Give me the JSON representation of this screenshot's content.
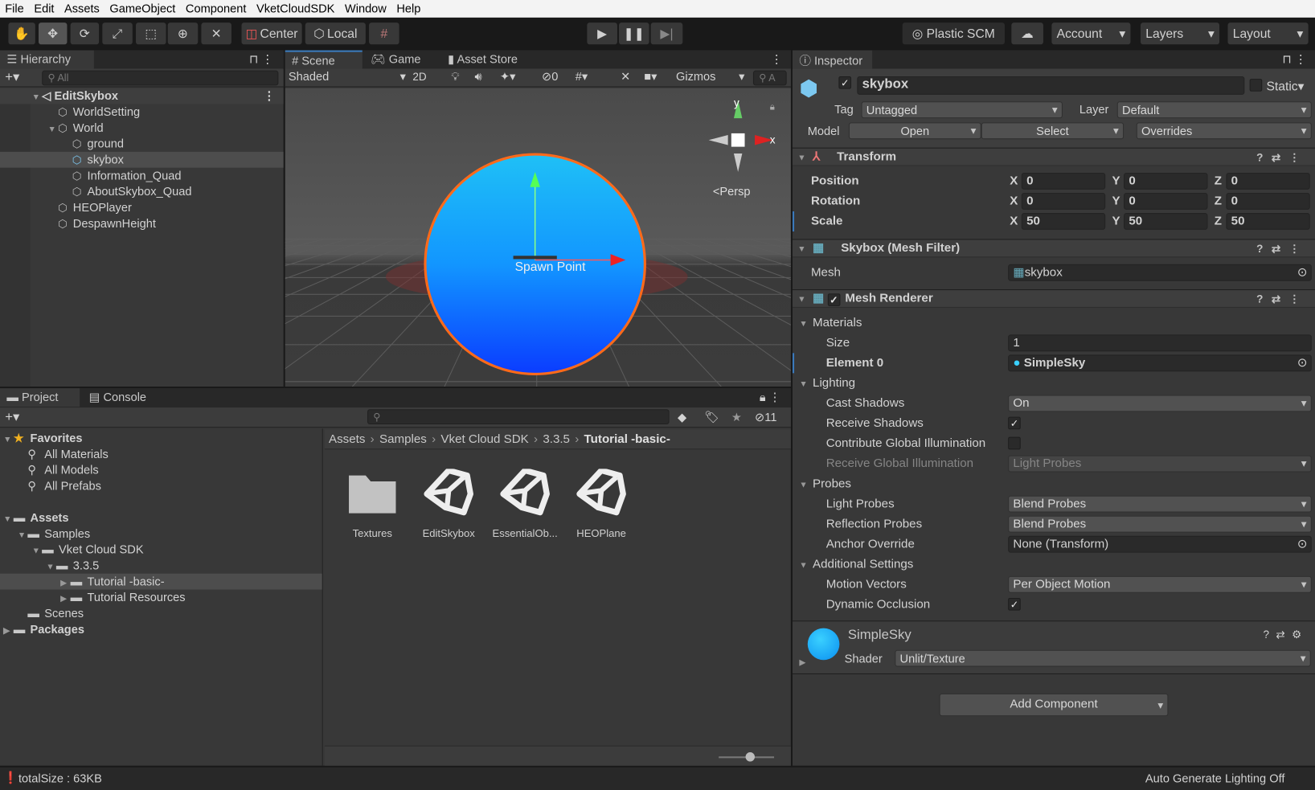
{
  "menu": [
    "File",
    "Edit",
    "Assets",
    "GameObject",
    "Component",
    "VketCloudSDK",
    "Window",
    "Help"
  ],
  "toolbar": {
    "tools": [
      "hand-tool",
      "move-tool",
      "rotate-tool",
      "scale-tool",
      "rect-tool",
      "transform-tool",
      "custom-tool"
    ],
    "center": "Center",
    "local": "Local",
    "plastic": "Plastic SCM",
    "account": "Account",
    "layers": "Layers",
    "layout": "Layout"
  },
  "hierarchy": {
    "title": "Hierarchy",
    "search_placeholder": "All",
    "scene": "EditSkybox",
    "items": [
      {
        "label": "WorldSetting",
        "depth": 1
      },
      {
        "label": "World",
        "depth": 1,
        "expanded": true
      },
      {
        "label": "ground",
        "depth": 2
      },
      {
        "label": "skybox",
        "depth": 2,
        "selected": true
      },
      {
        "label": "Information_Quad",
        "depth": 2
      },
      {
        "label": "AboutSkybox_Quad",
        "depth": 2
      },
      {
        "label": "HEOPlayer",
        "depth": 1
      },
      {
        "label": "DespawnHeight",
        "depth": 1
      }
    ]
  },
  "scene": {
    "tabs": [
      "Scene",
      "Game",
      "Asset Store"
    ],
    "shading": "Shaded",
    "mode2d": "2D",
    "hidden_count": "0",
    "gizmos": "Gizmos",
    "search": "A",
    "persp": "Persp",
    "spawn": "Spawn Point",
    "axis_x": "x",
    "axis_y": "y"
  },
  "inspector": {
    "title": "Inspector",
    "name": "skybox",
    "static": "Static",
    "tag_label": "Tag",
    "tag": "Untagged",
    "layer_label": "Layer",
    "layer": "Default",
    "model_label": "Model",
    "open": "Open",
    "select": "Select",
    "overrides": "Overrides",
    "transform": {
      "title": "Transform",
      "rows": [
        {
          "label": "Position",
          "x": "0",
          "y": "0",
          "z": "0"
        },
        {
          "label": "Rotation",
          "x": "0",
          "y": "0",
          "z": "0"
        },
        {
          "label": "Scale",
          "x": "50",
          "y": "50",
          "z": "50"
        }
      ]
    },
    "mesh_filter": {
      "title": "Skybox (Mesh Filter)",
      "mesh_label": "Mesh",
      "mesh": "skybox"
    },
    "mesh_renderer": {
      "title": "Mesh Renderer",
      "rows": [
        {
          "type": "fold",
          "label": "Materials"
        },
        {
          "type": "text",
          "label": "Size",
          "value": "1"
        },
        {
          "type": "object",
          "label": "Element 0",
          "value": "SimpleSky",
          "bold": true
        },
        {
          "type": "fold",
          "label": "Lighting"
        },
        {
          "type": "dropdown",
          "label": "Cast Shadows",
          "value": "On"
        },
        {
          "type": "check",
          "label": "Receive Shadows",
          "checked": true
        },
        {
          "type": "check",
          "label": "Contribute Global Illumination",
          "checked": false
        },
        {
          "type": "dropdown",
          "label": "Receive Global Illumination",
          "value": "Light Probes",
          "disabled": true
        },
        {
          "type": "fold",
          "label": "Probes"
        },
        {
          "type": "dropdown",
          "label": "Light Probes",
          "value": "Blend Probes"
        },
        {
          "type": "dropdown",
          "label": "Reflection Probes",
          "value": "Blend Probes"
        },
        {
          "type": "object",
          "label": "Anchor Override",
          "value": "None (Transform)"
        },
        {
          "type": "fold",
          "label": "Additional Settings"
        },
        {
          "type": "dropdown",
          "label": "Motion Vectors",
          "value": "Per Object Motion"
        },
        {
          "type": "check",
          "label": "Dynamic Occlusion",
          "checked": true
        }
      ]
    },
    "material": {
      "name": "SimpleSky",
      "shader_label": "Shader",
      "shader": "Unlit/Texture"
    },
    "add_component": "Add Component"
  },
  "project": {
    "tabs": [
      "Project",
      "Console"
    ],
    "hidden_count": "11",
    "tree": [
      {
        "label": "Favorites",
        "depth": 0,
        "icon": "star",
        "bold": true,
        "expanded": true
      },
      {
        "label": "All Materials",
        "depth": 1,
        "icon": "search"
      },
      {
        "label": "All Models",
        "depth": 1,
        "icon": "search"
      },
      {
        "label": "All Prefabs",
        "depth": 1,
        "icon": "search"
      },
      {
        "gap": true
      },
      {
        "label": "Assets",
        "depth": 0,
        "icon": "folder",
        "bold": true,
        "expanded": true
      },
      {
        "label": "Samples",
        "depth": 1,
        "icon": "folder",
        "expanded": true
      },
      {
        "label": "Vket Cloud SDK",
        "depth": 2,
        "icon": "folder",
        "expanded": true
      },
      {
        "label": "3.3.5",
        "depth": 3,
        "icon": "folder",
        "expanded": true
      },
      {
        "label": "Tutorial -basic-",
        "depth": 4,
        "icon": "folder",
        "selected": true,
        "collapsed": true
      },
      {
        "label": "Tutorial Resources",
        "depth": 4,
        "icon": "folder",
        "collapsed": true
      },
      {
        "label": "Scenes",
        "depth": 1,
        "icon": "folder"
      },
      {
        "label": "Packages",
        "depth": 0,
        "icon": "folder",
        "bold": true,
        "collapsed": true
      }
    ],
    "breadcrumb": [
      "Assets",
      "Samples",
      "Vket Cloud SDK",
      "3.3.5",
      "Tutorial -basic-"
    ],
    "files": [
      {
        "label": "Textures",
        "kind": "folder"
      },
      {
        "label": "EditSkybox",
        "kind": "unity"
      },
      {
        "label": "EssentialOb...",
        "kind": "unity"
      },
      {
        "label": "HEOPlane",
        "kind": "unity"
      }
    ]
  },
  "status": {
    "left": "totalSize : 63KB",
    "right": "Auto Generate Lighting Off"
  },
  "colors": {
    "accent": "#3a79bb",
    "sky_top": "#1fb6f5",
    "sky_bottom": "#0b3cff",
    "outline": "#ff6a1a"
  }
}
